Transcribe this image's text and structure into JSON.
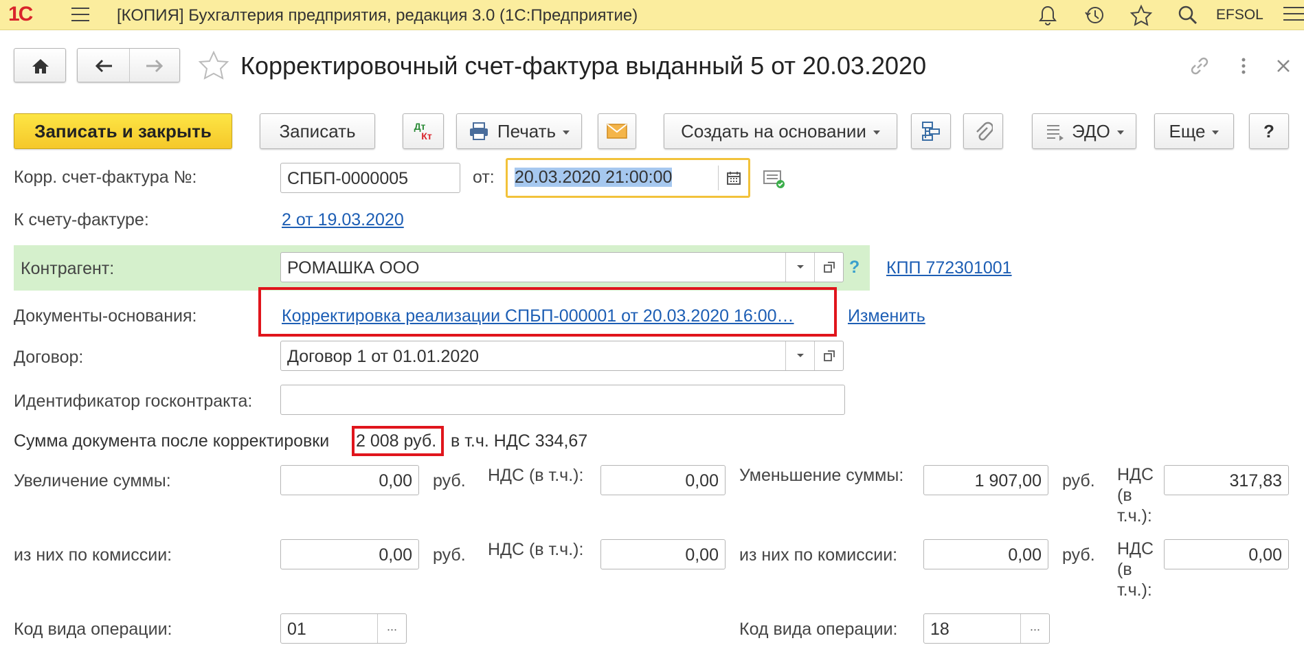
{
  "app": {
    "title": "[КОПИЯ] Бухгалтерия предприятия, редакция 3.0   (1С:Предприятие)",
    "user": "EFSOL",
    "logo_text": "1С"
  },
  "document": {
    "title": "Корректировочный счет-фактура выданный 5 от 20.03.2020"
  },
  "toolbar": {
    "save_close": "Записать и закрыть",
    "save": "Записать",
    "dt_label": "Дт",
    "kt_label": "Кт",
    "print": "Печать",
    "create_based": "Создать на основании",
    "edo": "ЭДО",
    "more": "Еще",
    "help": "?"
  },
  "form": {
    "number_label": "Корр. счет-фактура №:",
    "number_value": "СПБП-0000005",
    "from_label": "от:",
    "date_value": "20.03.2020 21:00:00",
    "invoice_label": "К счету-фактуре:",
    "invoice_link": "2 от 19.03.2020",
    "counterparty_label": "Контрагент:",
    "counterparty_value": "РОМАШКА ООО",
    "question": "?",
    "kpp_link": "КПП 772301001",
    "base_docs_label": "Документы-основания:",
    "base_docs_link": "Корректировка реализации СПБП-000001 от 20.03.2020 16:00…",
    "change_link": "Изменить",
    "contract_label": "Договор:",
    "contract_value": "Договор 1 от 01.01.2020",
    "gov_contract_label": "Идентификатор госконтракта:",
    "gov_contract_value": "",
    "sum_after_label": "Сумма документа после корректировки",
    "sum_after_value": "2 008 руб.",
    "sum_vat_text": "в т.ч. НДС 334,67",
    "increase_label": "Увеличение суммы:",
    "increase_value": "0,00",
    "rub": "руб.",
    "vat_incl_label": "НДС (в т.ч.):",
    "increase_vat_value": "0,00",
    "decrease_label": "Уменьшение суммы:",
    "decrease_value": "1 907,00",
    "vat_incl_label_wrap1": "НДС",
    "vat_incl_label_wrap2": "(в",
    "vat_incl_label_wrap3": "т.ч.):",
    "decrease_vat_value": "317,83",
    "commission_label": "из них по комиссии:",
    "commission_inc_value": "0,00",
    "commission_inc_vat_value": "0,00",
    "commission_dec_value": "0,00",
    "commission_dec_vat_value": "0,00",
    "op_code_label": "Код вида операции:",
    "op_code_left_value": "01",
    "op_code_right_value": "18",
    "ellipsis": "..."
  },
  "colors": {
    "header_bg": "#fbed9e",
    "primary_button": "#f5c82a",
    "highlight_row": "#d5f0cc",
    "link": "#1d5eb4",
    "annotation_red": "#e0151c",
    "date_focus": "#f2c23a"
  }
}
